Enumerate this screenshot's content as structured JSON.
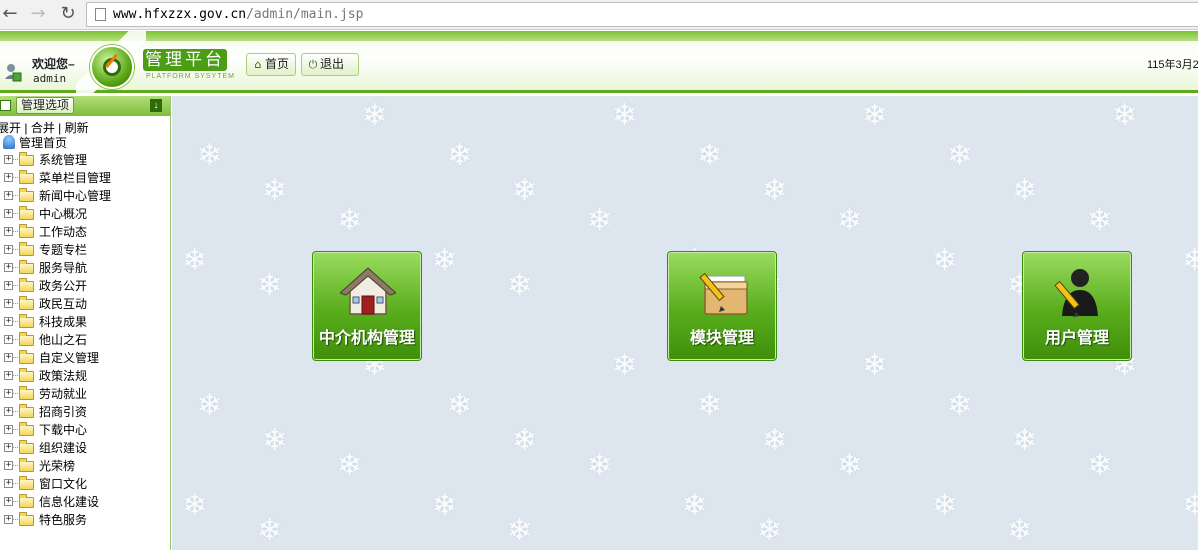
{
  "browser": {
    "url_host": "www.hfxzzx.gov.cn",
    "url_path": "/admin/main.jsp"
  },
  "header": {
    "welcome": "欢迎您–",
    "username": "admin",
    "platform_title": "管理平台",
    "platform_subtitle": "PLATFORM SYSYTEM",
    "home_button": "首页",
    "exit_button": "退出",
    "date": "115年3月2"
  },
  "sidebar": {
    "header_label": "管理选项",
    "actions": [
      "展开",
      "合并",
      "刷新"
    ],
    "action_separator": " | ",
    "root_label": "管理首页",
    "items": [
      {
        "label": "系统管理"
      },
      {
        "label": "菜单栏目管理"
      },
      {
        "label": "新闻中心管理"
      },
      {
        "label": "中心概况"
      },
      {
        "label": "工作动态"
      },
      {
        "label": "专题专栏"
      },
      {
        "label": "服务导航"
      },
      {
        "label": "政务公开"
      },
      {
        "label": "政民互动"
      },
      {
        "label": "科技成果"
      },
      {
        "label": "他山之石"
      },
      {
        "label": "自定义管理"
      },
      {
        "label": "政策法规"
      },
      {
        "label": "劳动就业"
      },
      {
        "label": "招商引资"
      },
      {
        "label": "下载中心"
      },
      {
        "label": "组织建设"
      },
      {
        "label": "光荣榜"
      },
      {
        "label": "窗口文化"
      },
      {
        "label": "信息化建设"
      },
      {
        "label": "特色服务"
      }
    ]
  },
  "main": {
    "tiles": [
      {
        "label": "中介机构管理",
        "icon": "house-icon"
      },
      {
        "label": "模块管理",
        "icon": "module-box-icon"
      },
      {
        "label": "用户管理",
        "icon": "user-pencil-icon"
      }
    ]
  },
  "colors": {
    "accent_green": "#5ea81a",
    "tile_green": "#58ad1c",
    "main_bg": "#dde6ee"
  }
}
